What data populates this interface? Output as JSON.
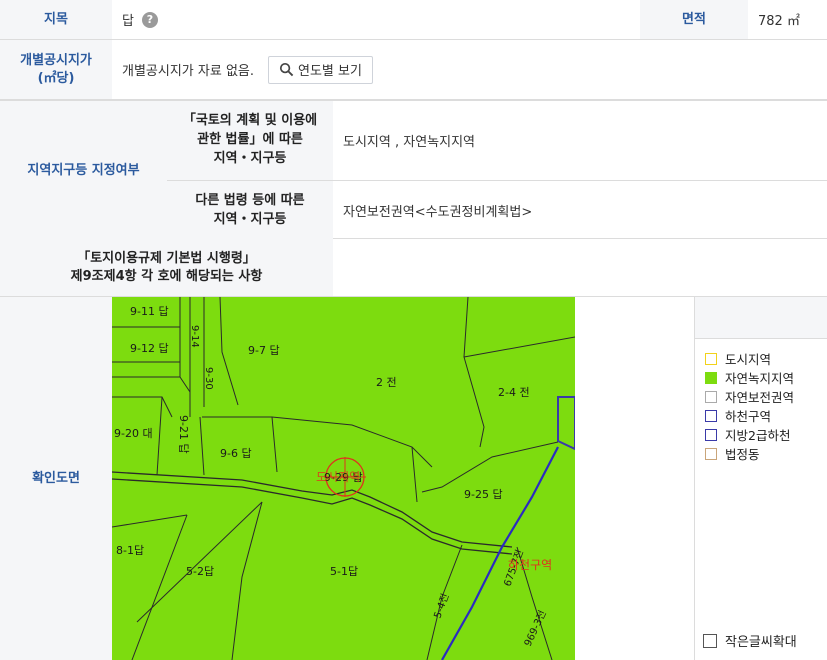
{
  "row1": {
    "jimok_label": "지목",
    "jimok_value": "답",
    "help": "?",
    "area_label": "면적",
    "area_value": "782 ㎡"
  },
  "row2": {
    "label_line1": "개별공시지가",
    "label_line2": "(㎡당)",
    "value": "개별공시지가 자료 없음.",
    "button": "연도별 보기"
  },
  "zoning": {
    "label": "지역지구등 지정여부",
    "sub1_line1": "「국토의 계획 및 이용에",
    "sub1_line2": "관한 법률」에 따른",
    "sub1_line3": "지역・지구등",
    "sub1_value": "도시지역 , 자연녹지지역",
    "sub2_line1": "다른 법령 등에 따른",
    "sub2_line2": "지역・지구등",
    "sub2_value": "자연보전권역<수도권정비계획법>"
  },
  "decree": {
    "line1": "「토지이용규제 기본법 시행령」",
    "line2": "제9조제4항 각 호에 해당되는 사항",
    "value": ""
  },
  "mapsec": {
    "label": "확인도면",
    "parcels": {
      "p911": "9-11 답",
      "p912": "9-12 답",
      "p97": "9-7 답",
      "p2": "2 전",
      "p24": "2-4 전",
      "p920": "9-20 대",
      "p921": "9-21 답",
      "p96": "9-6 답",
      "p925": "9-25 답",
      "p81": "8-1답",
      "p52": "5-2답",
      "p51": "5-1답",
      "p914": "9-14",
      "p930": "9-30",
      "p54": "5-4전",
      "p675": "675-7전",
      "p969": "969-3전",
      "target_label": "도시지역",
      "target_parcel": "9-29 답",
      "river_label": "하천구역"
    },
    "legend": [
      {
        "label": "도시지역",
        "color": "#f2d21b",
        "fill": "#ffffff"
      },
      {
        "label": "자연녹지지역",
        "color": "#7ddc0f",
        "fill": "#7ddc0f"
      },
      {
        "label": "자연보전권역",
        "color": "#aaaaaa",
        "fill": "#ffffff"
      },
      {
        "label": "하천구역",
        "color": "#3a3aa8",
        "fill": "#ffffff"
      },
      {
        "label": "지방2급하천",
        "color": "#3a3aa8",
        "fill": "#ffffff"
      },
      {
        "label": "법정동",
        "color": "#c9a57a",
        "fill": "#ffffff"
      }
    ],
    "small_font": "작은글씨확대"
  },
  "colors": {
    "header_text": "#2b5a9e",
    "map_green": "#7ddc0f",
    "accent_red": "#e0321e"
  }
}
